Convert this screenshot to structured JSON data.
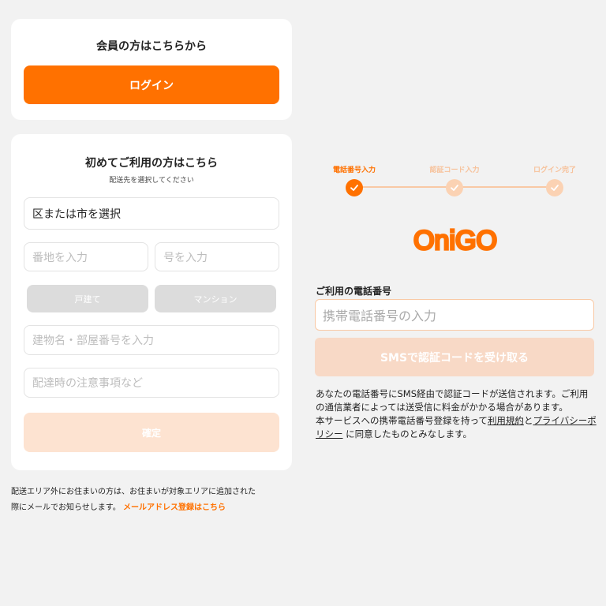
{
  "login_card": {
    "title": "会員の方はこちらから",
    "login_button": "ログイン"
  },
  "register_card": {
    "title": "初めてご利用の方はこちら",
    "subtitle": "配送先を選択してください",
    "area_select": "区または市を選択",
    "banchi_placeholder": "番地を入力",
    "go_placeholder": "号を入力",
    "house_type_options": [
      "戸建て",
      "マンション"
    ],
    "building_placeholder": "建物名・部屋番号を入力",
    "note_placeholder": "配達時の注意事項など",
    "confirm_button": "確定"
  },
  "footnote": {
    "text_line1": "配送エリア外にお住まいの方は、お住まいが対象エリアに追加された",
    "text_line2": "際にメールでお知らせします。",
    "link": "メールアドレス登録はこちら"
  },
  "stepper": {
    "steps": [
      {
        "label": "電話番号入力",
        "state": "active"
      },
      {
        "label": "認証コード入力",
        "state": "pending"
      },
      {
        "label": "ログイン完了",
        "state": "pending"
      }
    ]
  },
  "logo": {
    "text": "OniGO",
    "color": "#ff7100"
  },
  "phone": {
    "label": "ご利用の電話番号",
    "placeholder": "携帯電話番号の入力",
    "sms_button": "SMSで認証コードを受け取る"
  },
  "notice": {
    "para1": "あなたの電話番号にSMS経由で認証コードが送信されます。ご利用の通信業者によっては送受信に料金がかかる場合があります。",
    "para2_prefix": "本サービスへの携帯電話番号登録を持って",
    "terms_link": "利用規約",
    "and": "と",
    "privacy_link": "プライバシーポリシー",
    "para2_suffix": " に同意したものとみなします。"
  },
  "colors": {
    "accent": "#ff7100",
    "accent_light": "#fde3d1",
    "background": "#f2f2f2"
  }
}
